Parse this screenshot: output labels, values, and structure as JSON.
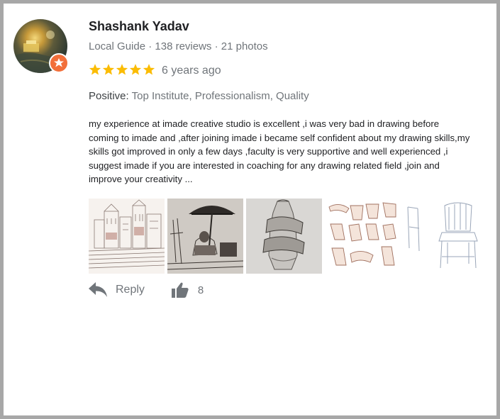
{
  "reviewer": {
    "name": "Shashank Yadav",
    "meta": "Local Guide · 138 reviews · 21 photos"
  },
  "rating": {
    "stars": 5,
    "max": 5,
    "time": "6 years ago",
    "star_color": "#fbbc04"
  },
  "positive": {
    "label": "Positive:",
    "value": "Top Institute, Professionalism, Quality"
  },
  "review_text": "my experience at imade creative studio is excellent ,i was very bad in drawing before coming to imade and ,after joining imade i became self confident about my drawing skills,my skills got improved in only a few days ,faculty is very supportive and well experienced ,i suggest imade if you are interested in coaching for any drawing related field ,join and improve your creativity ...",
  "photos": [
    {
      "icon": "sketch-ghats-photo"
    },
    {
      "icon": "sketch-umbrella-vendor-photo"
    },
    {
      "icon": "sketch-draped-vase-photo"
    },
    {
      "icon": "sketch-hands-photo"
    },
    {
      "icon": "sketch-chair-photo"
    }
  ],
  "actions": {
    "reply_label": "Reply",
    "like_count": "8"
  },
  "colors": {
    "badge": "#f26f3a",
    "secondary_text": "#70757a",
    "icon": "#70757a"
  }
}
